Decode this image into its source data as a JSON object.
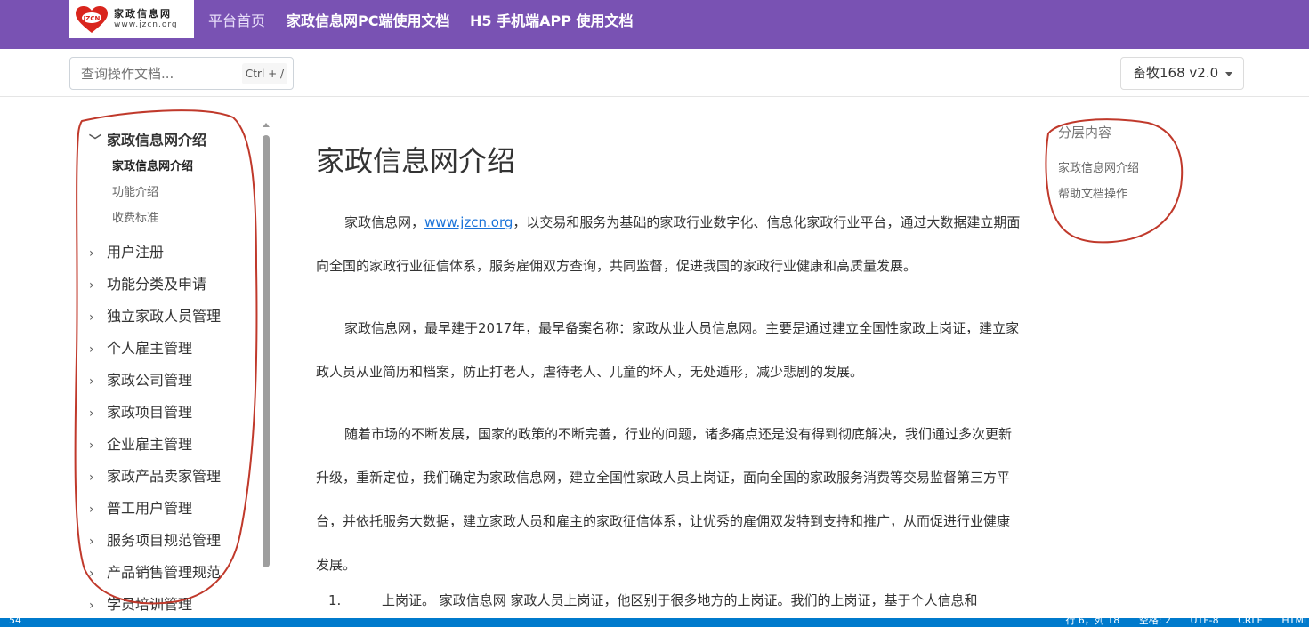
{
  "header": {
    "logo_cn": "家政信息网",
    "logo_url": "www.jzcn.org",
    "logo_badge": "JZCN",
    "nav": [
      "平台首页",
      "家政信息网PC端使用文档",
      "H5 手机端APP 使用文档"
    ]
  },
  "search": {
    "placeholder": "查询操作文档...",
    "shortcut": "Ctrl + /"
  },
  "version": {
    "selected": "畜牧168 v2.0"
  },
  "sidebar": {
    "expanded_group": "家政信息网介绍",
    "sub_items": [
      "家政信息网介绍",
      "功能介绍",
      "收费标准"
    ],
    "groups": [
      "用户注册",
      "功能分类及申请",
      "独立家政人员管理",
      "个人雇主管理",
      "家政公司管理",
      "家政项目管理",
      "企业雇主管理",
      "家政产品卖家管理",
      "普工用户管理",
      "服务项目规范管理",
      "产品销售管理规范",
      "学员培训管理"
    ]
  },
  "main": {
    "title": "家政信息网介绍",
    "p1_before": "家政信息网，",
    "p1_link": "www.jzcn.org",
    "p1_after": "，以交易和服务为基础的家政行业数字化、信息化家政行业平台，通过大数据建立期面向全国的家政行业征信体系，服务雇佣双方查询，共同监督，促进我国的家政行业健康和高质量发展。",
    "p2": "家政信息网，最早建于2017年，最早备案名称：家政从业人员信息网。主要是通过建立全国性家政上岗证，建立家政人员从业简历和档案，防止打老人，虐待老人、儿童的坏人，无处遁形，减少悲剧的发展。",
    "p3": "随着市场的不断发展，国家的政策的不断完善，行业的问题，诸多痛点还是没有得到彻底解决，我们通过多次更新升级，重新定位，我们确定为家政信息网，建立全国性家政人员上岗证，面向全国的家政服务消费等交易监督第三方平台，并依托服务大数据，建立家政人员和雇主的家政征信体系，让优秀的雇佣双发特到支持和推广，从而促进行业健康发展。",
    "list_num": "1.",
    "list_text": "上岗证。 家政信息网 家政人员上岗证，他区别于很多地方的上岗证。我们的上岗证，基于个人信息和"
  },
  "toc": {
    "title": "分层内容",
    "items": [
      "家政信息网介绍",
      "帮助文档操作"
    ]
  },
  "statusbar": {
    "left": "54",
    "right": [
      "行 6，列 18",
      "空格: 2",
      "UTF-8",
      "CRLF",
      "HTML"
    ]
  },
  "colors": {
    "navbar": "#7952b3",
    "link": "#1a73d9",
    "annotation": "#c0392b",
    "statusbar": "#007acc"
  }
}
